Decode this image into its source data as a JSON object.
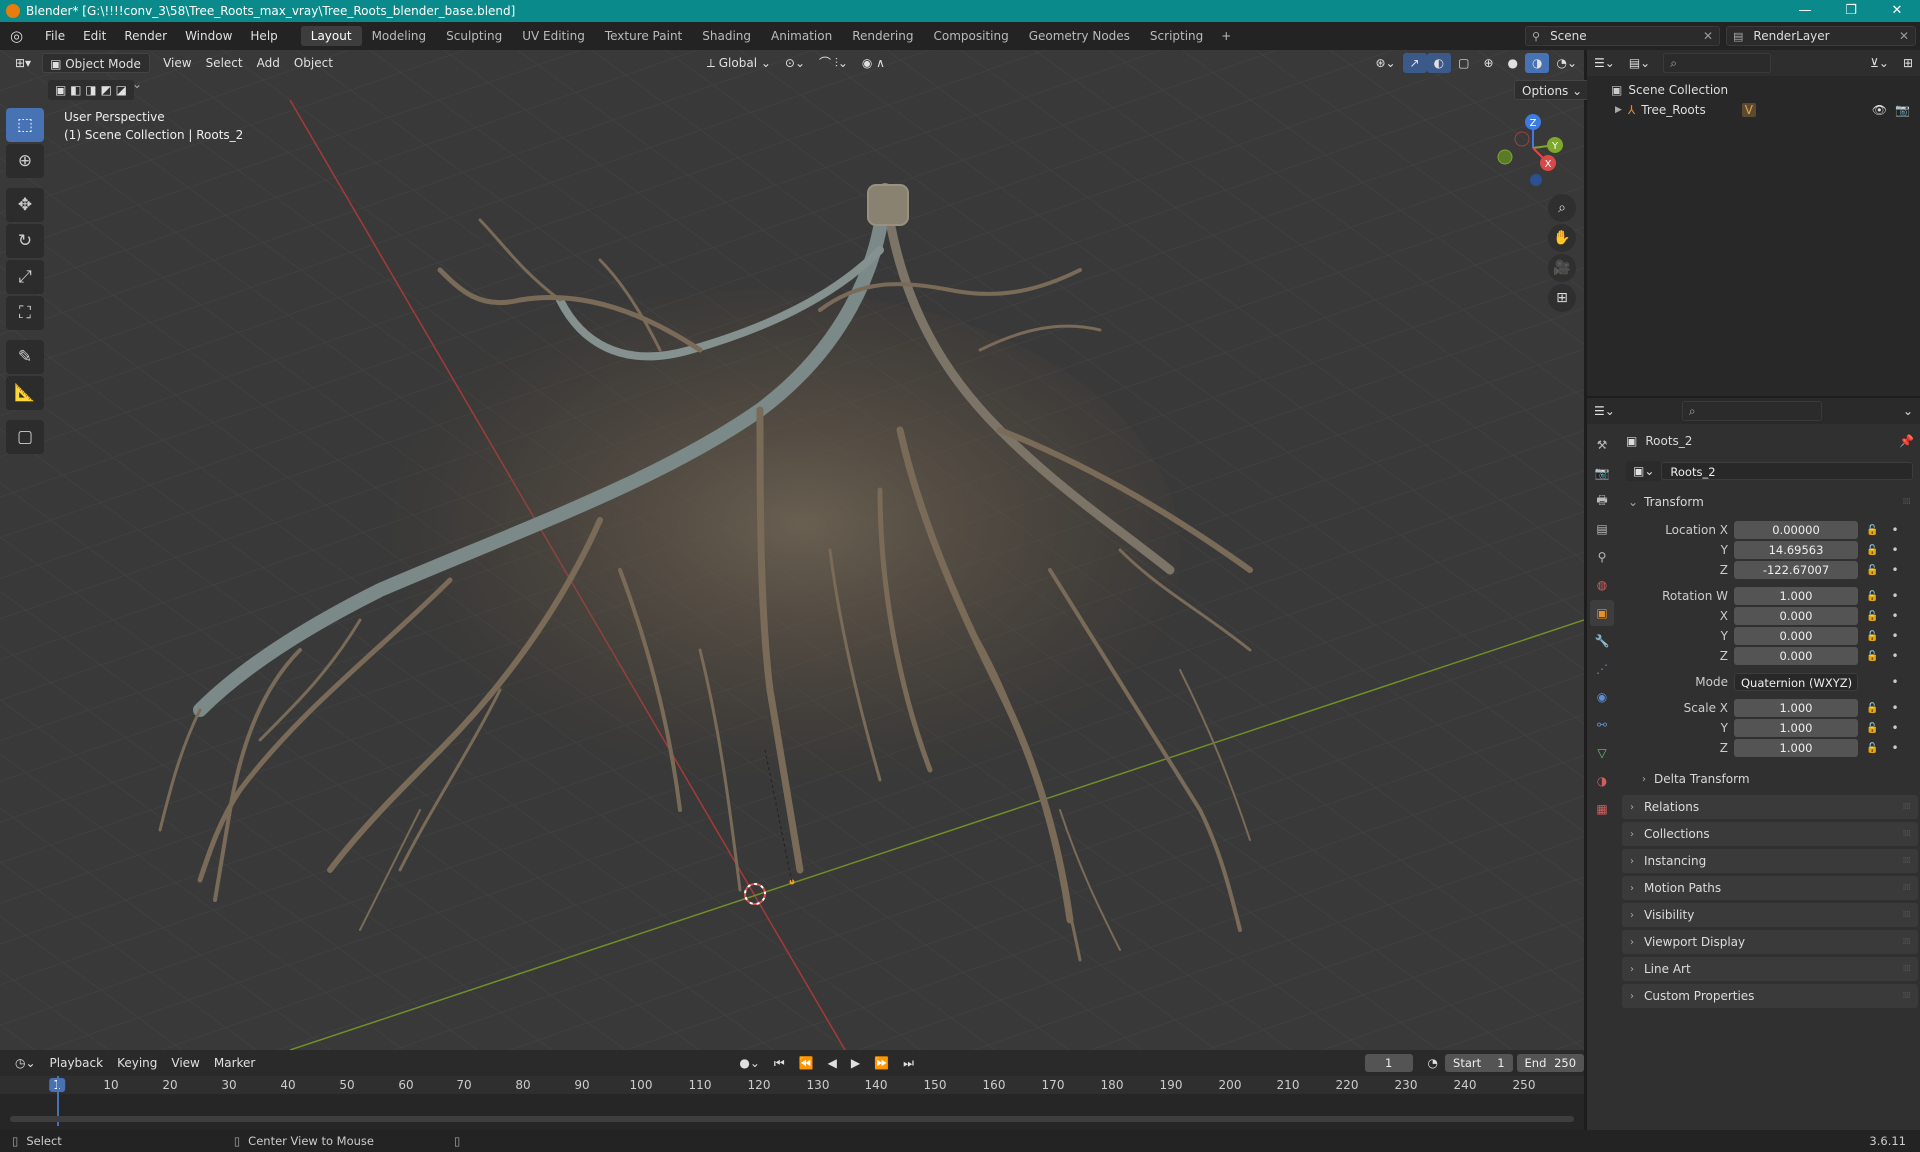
{
  "window": {
    "title": "Blender* [G:\\!!!!conv_3\\58\\Tree_Roots_max_vray\\Tree_Roots_blender_base.blend]",
    "buttons": [
      "—",
      "❐",
      "✕"
    ]
  },
  "menubar": {
    "items": [
      "File",
      "Edit",
      "Render",
      "Window",
      "Help"
    ],
    "workspaces": [
      "Layout",
      "Modeling",
      "Sculpting",
      "UV Editing",
      "Texture Paint",
      "Shading",
      "Animation",
      "Rendering",
      "Compositing",
      "Geometry Nodes",
      "Scripting"
    ],
    "active_workspace": "Layout",
    "scene": "Scene",
    "view_layer": "RenderLayer"
  },
  "viewport": {
    "mode": "Object Mode",
    "menus": [
      "View",
      "Select",
      "Add",
      "Object"
    ],
    "orientation": "Global",
    "options_label": "Options",
    "perspective_label": "User Perspective",
    "collection_label": "(1) Scene Collection | Roots_2",
    "gizmo_axes": [
      "X",
      "Y",
      "Z"
    ]
  },
  "outliner": {
    "root": "Scene Collection",
    "items": [
      {
        "label": "Tree_Roots"
      }
    ]
  },
  "properties": {
    "object_name": "Roots_2",
    "data_name": "Roots_2",
    "transform_title": "Transform",
    "location": {
      "label": "Location X",
      "x": "0.00000",
      "y": "14.69563",
      "z": "-122.67007"
    },
    "rotation": {
      "label": "Rotation W",
      "w": "1.000",
      "x": "0.000",
      "y": "0.000",
      "z": "0.000"
    },
    "mode_label": "Mode",
    "mode_value": "Quaternion (WXYZ)",
    "scale": {
      "label": "Scale X",
      "x": "1.000",
      "y": "1.000",
      "z": "1.000"
    },
    "axis_labels": {
      "x": "X",
      "y": "Y",
      "z": "Z"
    },
    "delta_transform": "Delta Transform",
    "panels": [
      "Relations",
      "Collections",
      "Instancing",
      "Motion Paths",
      "Visibility",
      "Viewport Display",
      "Line Art",
      "Custom Properties"
    ]
  },
  "timeline": {
    "menus": [
      "Playback",
      "Keying",
      "View",
      "Marker"
    ],
    "current_frame": "1",
    "start_label": "Start",
    "start": "1",
    "end_label": "End",
    "end": "250",
    "ticks": [
      "1",
      "10",
      "20",
      "30",
      "40",
      "50",
      "60",
      "70",
      "80",
      "90",
      "100",
      "110",
      "120",
      "130",
      "140",
      "150",
      "160",
      "170",
      "180",
      "190",
      "200",
      "210",
      "220",
      "230",
      "240",
      "250"
    ]
  },
  "statusbar": {
    "select": "Select",
    "center": "Center View to Mouse",
    "version": "3.6.11"
  },
  "colors": {
    "titlebar": "#0a8a8a",
    "accent": "#4772b3",
    "x_axis": "#d94848",
    "y_axis": "#7ea82b",
    "z_axis": "#3d7be0"
  }
}
